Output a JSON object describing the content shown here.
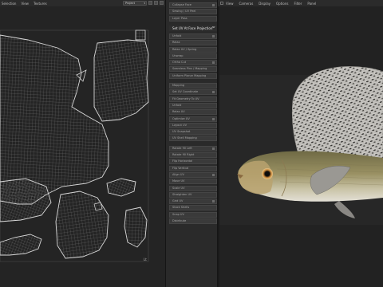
{
  "uv_editor": {
    "menu": [
      "Selection",
      "View",
      "Textures"
    ],
    "projection_select": "Project",
    "status_label": "Lt"
  },
  "mid_panel": {
    "items": [
      {
        "label": "Collapse Face",
        "kind": "normal"
      },
      {
        "label": "Sewing / UV Peel",
        "kind": "normal"
      },
      {
        "label": "Layer Pass",
        "kind": "normal"
      },
      {
        "label": "Set UV At Face Projection",
        "kind": "active"
      },
      {
        "label": "Unfold",
        "kind": "normal"
      },
      {
        "label": "Relax",
        "kind": "normal"
      },
      {
        "label": "Relax UV / Spring",
        "kind": "normal"
      },
      {
        "label": "Unwrap",
        "kind": "normal"
      },
      {
        "label": "Ortho Cut",
        "kind": "normal"
      },
      {
        "label": "Seamless Pins / Mapping",
        "kind": "normal"
      },
      {
        "label": "Uniform Planar Mapping",
        "kind": "normal"
      },
      {
        "label": "Mapping",
        "kind": "normal"
      },
      {
        "label": "Set UV Coordinate",
        "kind": "normal"
      },
      {
        "label": "Fit Geometry To UV",
        "kind": "normal"
      },
      {
        "label": "Unfold",
        "kind": "normal"
      },
      {
        "label": "Relax UV",
        "kind": "normal"
      },
      {
        "label": "Optimize UV",
        "kind": "normal"
      },
      {
        "label": "Layout UV",
        "kind": "normal"
      },
      {
        "label": "UV Snapshot",
        "kind": "normal"
      },
      {
        "label": "UV Shell Mapping",
        "kind": "normal"
      },
      {
        "label": "Rotate 90 Left",
        "kind": "normal"
      },
      {
        "label": "Rotate 90 Right",
        "kind": "normal"
      },
      {
        "label": "Flip Horizontal",
        "kind": "normal"
      },
      {
        "label": "Flip Vertical",
        "kind": "normal"
      },
      {
        "label": "Align UV",
        "kind": "normal"
      },
      {
        "label": "Move UV",
        "kind": "normal"
      },
      {
        "label": "Scale UV",
        "kind": "normal"
      },
      {
        "label": "Straighten UV",
        "kind": "normal"
      },
      {
        "label": "Grid UV",
        "kind": "normal"
      },
      {
        "label": "Stack Shells",
        "kind": "normal"
      },
      {
        "label": "Snap UV",
        "kind": "normal"
      },
      {
        "label": "Distribute",
        "kind": "normal"
      }
    ]
  },
  "viewport": {
    "menu": [
      "View",
      "Cameras",
      "Display",
      "Options",
      "Filter",
      "Panel"
    ]
  },
  "colors": {
    "accent": "#3a3a3a",
    "uv_wire": "#c8c8c8",
    "background": "#222222"
  }
}
